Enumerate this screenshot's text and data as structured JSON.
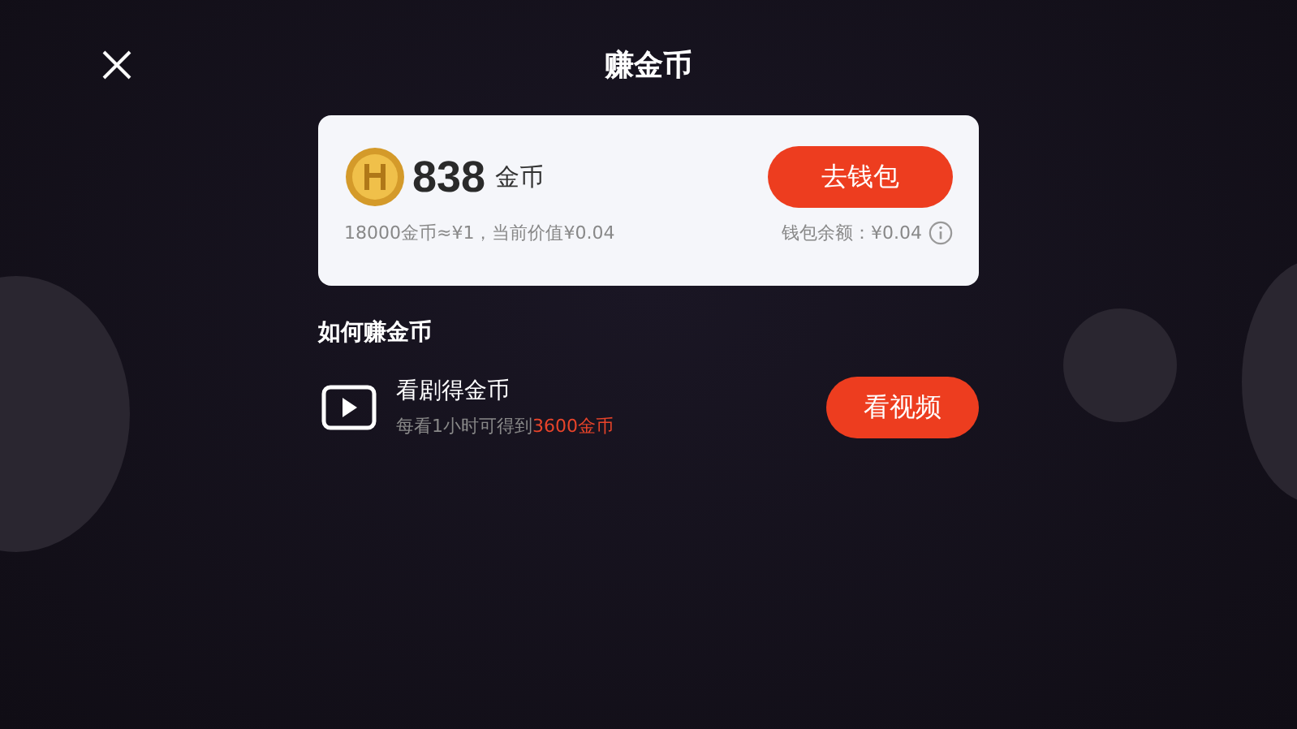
{
  "header": {
    "title": "赚金币"
  },
  "balance_card": {
    "amount": "838",
    "unit": "金币",
    "rate": "18000金币≈¥1，当前价值¥0.04",
    "button": "去钱包",
    "wallet_balance": "钱包余额：¥0.04"
  },
  "section": {
    "title": "如何赚金币"
  },
  "tasks": [
    {
      "title": "看剧得金币",
      "subtitle": "每看1小时可得到",
      "reward": "3600金币",
      "button": "看视频"
    }
  ]
}
